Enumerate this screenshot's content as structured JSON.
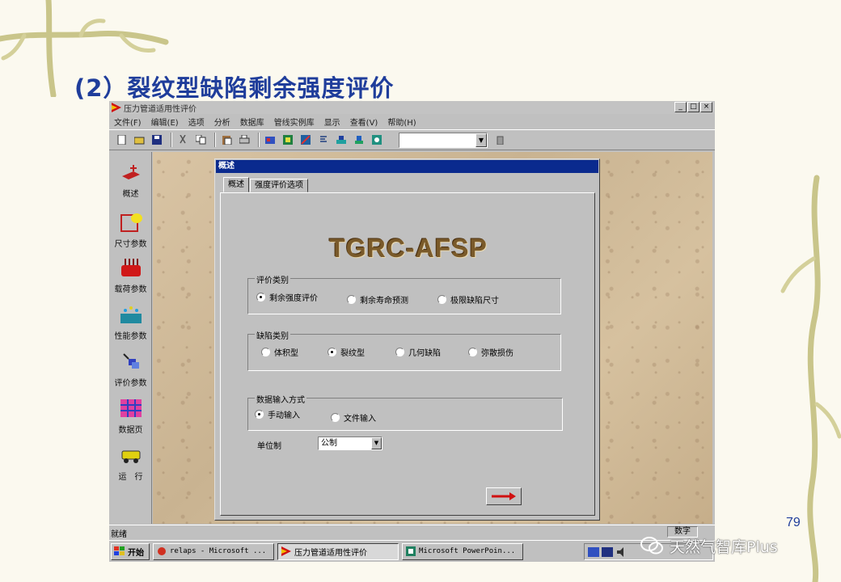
{
  "slide": {
    "title": "(2）裂纹型缺陷剩余强度评价",
    "page_number": "79",
    "watermark": "天然气智库Plus"
  },
  "app": {
    "title": "压力管道适用性评价",
    "window_buttons": [
      "_",
      "□",
      "×"
    ],
    "menu": [
      "文件(F)",
      "编辑(E)",
      "选项",
      "分析",
      "数据库",
      "管线实例库",
      "显示",
      "查看(V)",
      "帮助(H)"
    ],
    "toolbar_icons": [
      "new-icon",
      "open-icon",
      "save-icon",
      "cut-icon",
      "copy-icon",
      "paste-icon",
      "print-icon",
      "tool-icon-1",
      "tool-icon-2",
      "tool-icon-3",
      "tool-icon-4",
      "tool-icon-5",
      "tool-icon-6",
      "tool-icon-7"
    ],
    "toolbar_combo": ""
  },
  "sidebar": {
    "items": [
      {
        "label": "概述",
        "icon": "overview-icon"
      },
      {
        "label": "尺寸参数",
        "icon": "dimension-icon"
      },
      {
        "label": "载荷参数",
        "icon": "load-icon"
      },
      {
        "label": "性能参数",
        "icon": "property-icon"
      },
      {
        "label": "评价参数",
        "icon": "evaluation-icon"
      },
      {
        "label": "数据页",
        "icon": "datasheet-icon"
      },
      {
        "label": "运　行",
        "icon": "run-icon"
      }
    ]
  },
  "dialog": {
    "title": "概述",
    "tabs": [
      "概述",
      "强度评价选项"
    ],
    "logo": "TGRC-AFSP",
    "eval_group": {
      "label": "评价类别",
      "options": [
        "剩余强度评价",
        "剩余寿命预测",
        "极限缺陷尺寸"
      ],
      "selected": 0
    },
    "defect_group": {
      "label": "缺陷类别",
      "options": [
        "体积型",
        "裂纹型",
        "几何缺陷",
        "弥散损伤"
      ],
      "selected": 1
    },
    "input_group": {
      "label": "数据输入方式",
      "options": [
        "手动输入",
        "文件输入"
      ],
      "selected": 0
    },
    "unit_label": "单位制",
    "unit_value": "公制"
  },
  "statusbar": {
    "text": "就绪",
    "cell": "数字"
  },
  "taskbar": {
    "start": "开始",
    "tasks": [
      "relaps - Microsoft ...",
      "压力管道适用性评价",
      "Microsoft PowerPoin..."
    ]
  },
  "colors": {
    "title_blue": "#1f3d9b",
    "dialog_title": "#0a2a8e",
    "win_gray": "#c0c0c0"
  }
}
